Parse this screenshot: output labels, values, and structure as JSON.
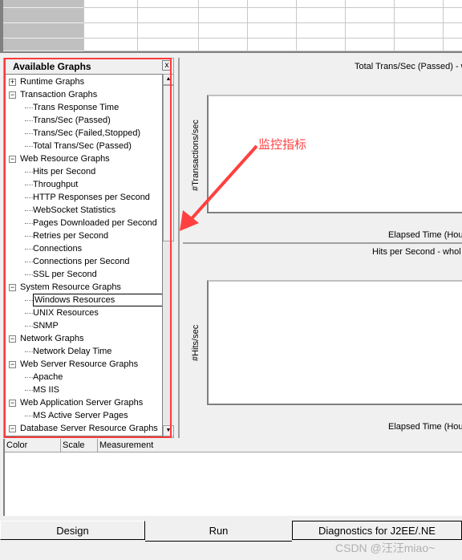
{
  "left_panel": {
    "title": "Available Graphs",
    "close_label": "x",
    "tree": [
      {
        "label": "Runtime Graphs",
        "level": 0,
        "expander": "+"
      },
      {
        "label": "Transaction Graphs",
        "level": 0,
        "expander": "-"
      },
      {
        "label": "Trans Response Time",
        "level": 1
      },
      {
        "label": "Trans/Sec (Passed)",
        "level": 1
      },
      {
        "label": "Trans/Sec (Failed,Stopped)",
        "level": 1
      },
      {
        "label": "Total Trans/Sec (Passed)",
        "level": 1
      },
      {
        "label": "Web Resource Graphs",
        "level": 0,
        "expander": "-"
      },
      {
        "label": "Hits per Second",
        "level": 1
      },
      {
        "label": "Throughput",
        "level": 1
      },
      {
        "label": "HTTP Responses per Second",
        "level": 1
      },
      {
        "label": "WebSocket Statistics",
        "level": 1
      },
      {
        "label": "Pages Downloaded per Second",
        "level": 1
      },
      {
        "label": "Retries per Second",
        "level": 1
      },
      {
        "label": "Connections",
        "level": 1
      },
      {
        "label": "Connections per Second",
        "level": 1
      },
      {
        "label": "SSL per Second",
        "level": 1
      },
      {
        "label": "System Resource Graphs",
        "level": 0,
        "expander": "-"
      },
      {
        "label": "Windows Resources",
        "level": 1,
        "selected": true
      },
      {
        "label": "UNIX Resources",
        "level": 1
      },
      {
        "label": "SNMP",
        "level": 1
      },
      {
        "label": "Network Graphs",
        "level": 0,
        "expander": "-"
      },
      {
        "label": "Network Delay Time",
        "level": 1
      },
      {
        "label": "Web Server Resource Graphs",
        "level": 0,
        "expander": "-"
      },
      {
        "label": "Apache",
        "level": 1
      },
      {
        "label": "MS IIS",
        "level": 1
      },
      {
        "label": "Web Application Server Graphs",
        "level": 0,
        "expander": "-"
      },
      {
        "label": "MS Active Server Pages",
        "level": 1
      },
      {
        "label": "Database Server Resource Graphs",
        "level": 0,
        "expander": "-"
      }
    ]
  },
  "charts": [
    {
      "title": "Total Trans/Sec (Passed) - w",
      "ylabel": "#Transactions/sec",
      "xlabel": "Elapsed Time (Hour"
    },
    {
      "title": "Hits per Second - whol",
      "ylabel": "#Hits/sec",
      "xlabel": "Elapsed Time (Hour"
    }
  ],
  "annotation": "监控指标",
  "legend": {
    "columns": [
      "Color",
      "Scale",
      "Measurement"
    ]
  },
  "tabs": [
    {
      "label": "Design"
    },
    {
      "label": "Run",
      "active": true
    },
    {
      "label": "Diagnostics for J2EE/.NE"
    }
  ],
  "watermark": "CSDN @汪汪miao~",
  "colors": {
    "highlight": "#ff3b3b"
  }
}
